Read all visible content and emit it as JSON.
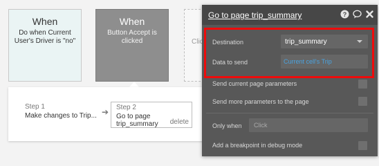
{
  "workflow": {
    "events": [
      {
        "title": "When",
        "description": "Do when Current User's Driver is \"no\""
      },
      {
        "title": "When",
        "description": "Button Accept is clicked"
      }
    ],
    "add_event_hint": "Click",
    "steps": [
      {
        "label": "Step 1",
        "name": "Make changes to Trip..."
      },
      {
        "label": "Step 2",
        "name": "Go to page trip_summary",
        "delete": "delete"
      }
    ]
  },
  "panel": {
    "title": "Go to page trip_summary",
    "icons": [
      "help-icon",
      "comment-icon",
      "close-icon"
    ],
    "destination_label": "Destination",
    "destination_value": "trip_summary",
    "data_to_send_label": "Data to send",
    "data_to_send_value": "Current cell's Trip",
    "send_current_params_label": "Send current page parameters",
    "send_more_params_label": "Send more parameters to the page",
    "only_when_label": "Only when",
    "only_when_placeholder": "Click",
    "breakpoint_label": "Add a breakpoint in debug mode"
  },
  "colors": {
    "highlight": "#ef0b0b",
    "panel_bg": "#585858",
    "link": "#4aa3df"
  }
}
